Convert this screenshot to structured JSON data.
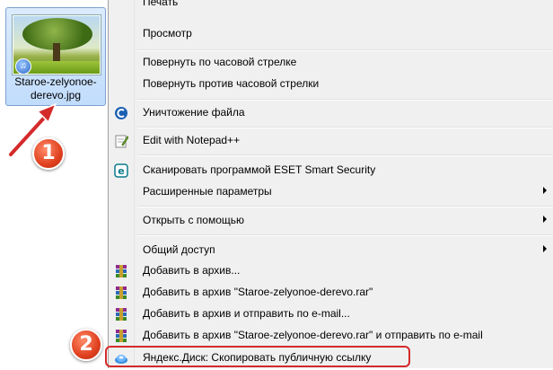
{
  "file": {
    "name": "Staroe-zelyonoe-derevo.jpg",
    "name_line1": "Staroe-zelyonoe-",
    "name_line2": "derevo.jpg"
  },
  "menu": {
    "items": [
      {
        "label": "Печать",
        "icon": ""
      },
      {
        "label": "Просмотр",
        "icon": ""
      },
      {
        "label": "Повернуть по часовой стрелке",
        "icon": ""
      },
      {
        "label": "Повернуть против часовой стрелки",
        "icon": ""
      },
      {
        "label": "Уничтожение файла",
        "icon": "ccleaner-icon"
      },
      {
        "label": "Edit with Notepad++",
        "icon": "notepad-icon"
      },
      {
        "label": "Сканировать программой ESET Smart Security",
        "icon": "eset-icon"
      },
      {
        "label": "Расширенные параметры",
        "icon": "",
        "submenu": true
      },
      {
        "label": "Открыть с помощью",
        "icon": "",
        "submenu": true
      },
      {
        "label": "Общий доступ",
        "icon": "",
        "submenu": true
      },
      {
        "label": "Добавить в архив...",
        "icon": "winrar-icon"
      },
      {
        "label": "Добавить в архив \"Staroe-zelyonoe-derevo.rar\"",
        "icon": "winrar-icon"
      },
      {
        "label": "Добавить в архив и отправить по e-mail...",
        "icon": "winrar-icon"
      },
      {
        "label": "Добавить в архив \"Staroe-zelyonoe-derevo.rar\" и отправить по e-mail",
        "icon": "winrar-icon"
      },
      {
        "label": "Яндекс.Диск: Скопировать публичную ссылку",
        "icon": "yandex-disk-icon"
      }
    ]
  },
  "callouts": {
    "one": "1",
    "two": "2"
  },
  "colors": {
    "highlight": "#d42a2a",
    "callout": "#e0401e"
  }
}
